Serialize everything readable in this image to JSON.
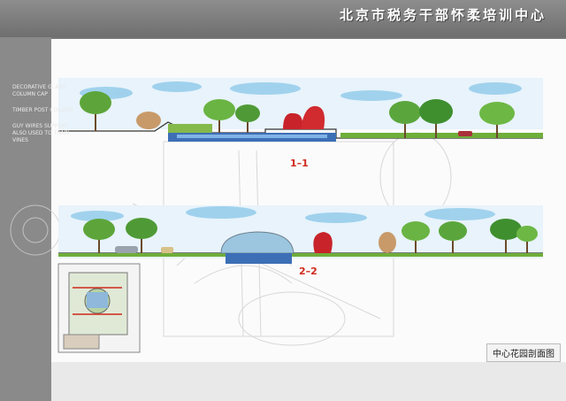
{
  "title": "北京市税务干部怀柔培训中心",
  "section_labels": {
    "top": "1–1",
    "bottom": "2–2"
  },
  "caption": "中心花园剖面图",
  "left_notes": [
    "DECORATIVE GLASS COLUMN CAP",
    "TIMBER POST COLUMN",
    "GUY WIRES SUPPORT ALSO USED TO TRAIN VINES"
  ]
}
